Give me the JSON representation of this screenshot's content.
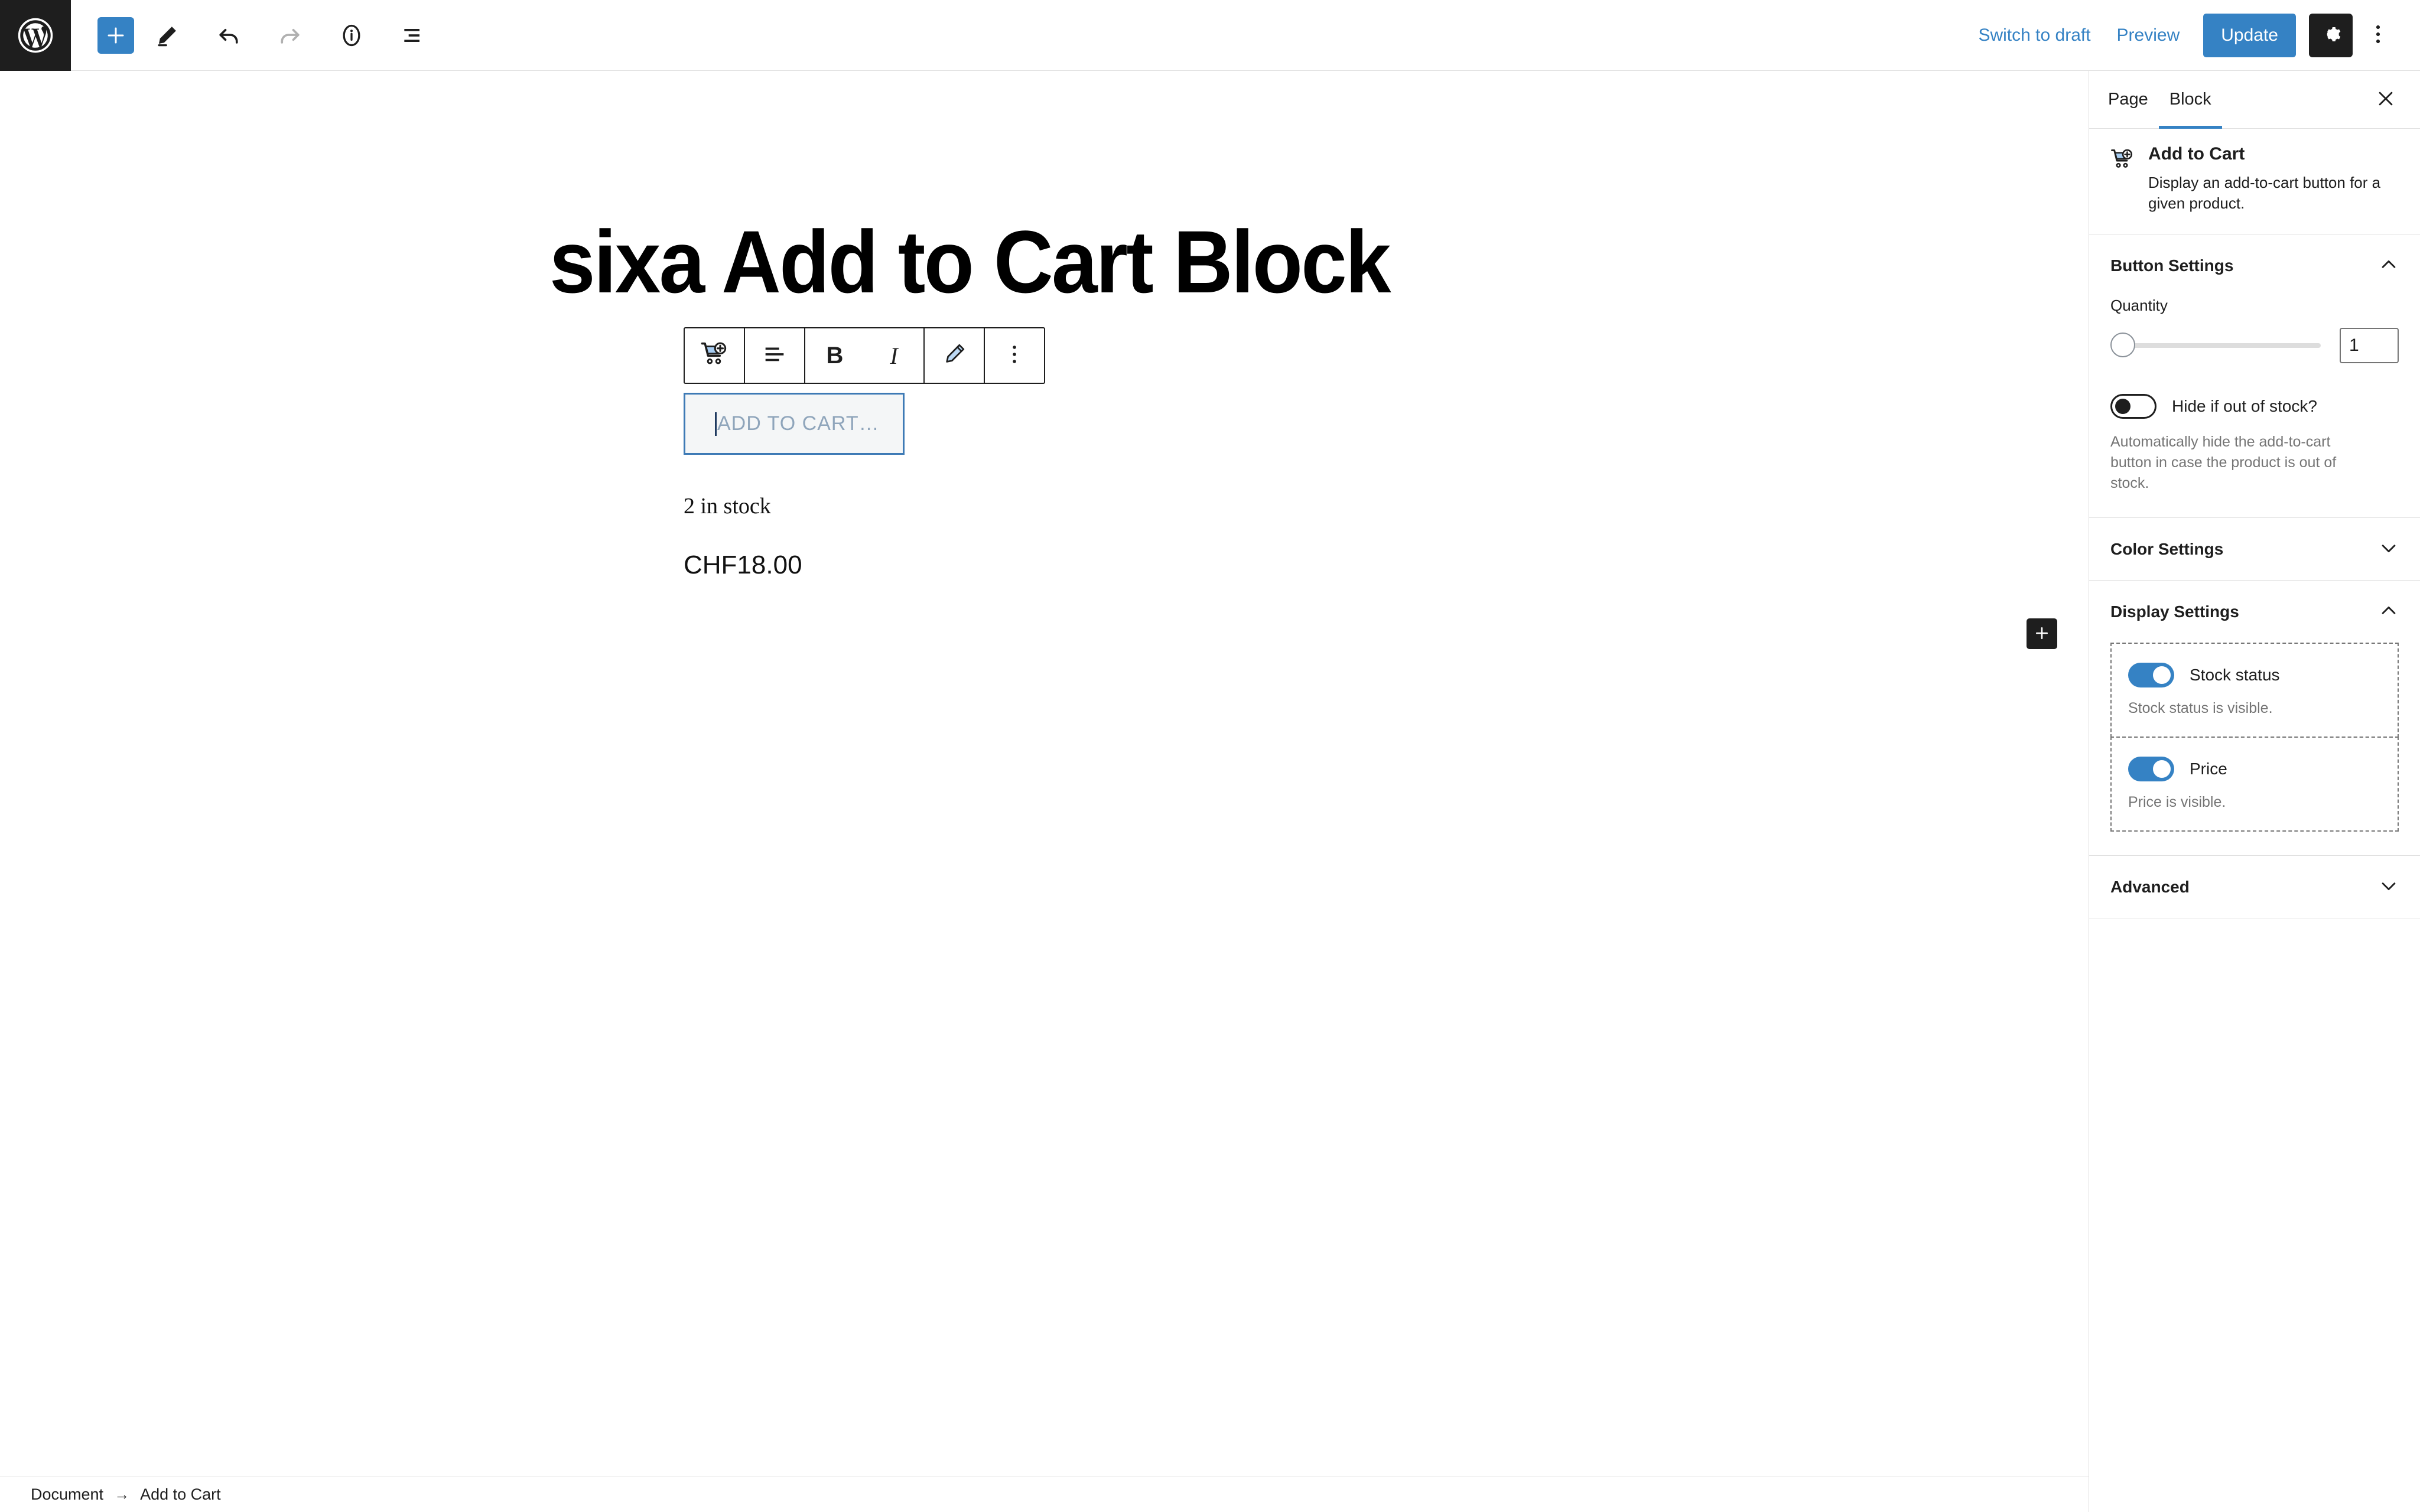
{
  "header": {
    "logo_icon": "wordpress-logo",
    "tools": [
      {
        "name": "add-block-button",
        "icon": "plus-icon"
      },
      {
        "name": "tools-pen-button",
        "icon": "pencil-icon"
      },
      {
        "name": "undo-button",
        "icon": "undo-arrow-icon"
      },
      {
        "name": "redo-button",
        "icon": "redo-arrow-icon"
      },
      {
        "name": "details-button",
        "icon": "info-circle-icon"
      },
      {
        "name": "list-view-button",
        "icon": "list-view-icon"
      }
    ],
    "switch_to_draft": "Switch to draft",
    "preview": "Preview",
    "update": "Update",
    "settings_icon": "gear-icon",
    "more_icon": "three-dots-vertical-icon",
    "accent_blue": "#3582c4",
    "dark": "#1e1e1e"
  },
  "canvas": {
    "post_title": "sixa Add to Cart Block",
    "toolbar": {
      "block_icon": "add-to-cart-icon",
      "align_icon": "align-left-icon",
      "bold_label": "B",
      "italic_label": "I",
      "link_icon": "pencil-icon",
      "more_icon": "three-dots-vertical-icon"
    },
    "add_to_cart_button": {
      "placeholder": "ADD TO CART…",
      "border_color": "#3d7ab5",
      "background": "#f4f6f7",
      "text_color": "#8fa5bb"
    },
    "stock_text": "2 in stock",
    "price_text": "CHF18.00",
    "inserter_icon": "plus-icon"
  },
  "sidebar": {
    "tabs": [
      {
        "label": "Page",
        "active": false
      },
      {
        "label": "Block",
        "active": true
      }
    ],
    "close_icon": "close-x-icon",
    "block_card": {
      "icon": "add-to-cart-icon",
      "title": "Add to Cart",
      "description": "Display an add-to-cart button for a given product."
    },
    "panels": [
      {
        "id": "button-settings",
        "title": "Button Settings",
        "expanded": true,
        "chevron": "chevron-up-icon"
      },
      {
        "id": "color-settings",
        "title": "Color Settings",
        "expanded": false,
        "chevron": "chevron-down-icon"
      },
      {
        "id": "display-settings",
        "title": "Display Settings",
        "expanded": true,
        "chevron": "chevron-up-icon"
      },
      {
        "id": "advanced",
        "title": "Advanced",
        "expanded": false,
        "chevron": "chevron-down-icon"
      }
    ],
    "button_settings": {
      "quantity_label": "Quantity",
      "quantity_value": "1",
      "slider_min": 1,
      "slider_max": 100,
      "slider_position_pct": 0,
      "hide_out_of_stock_label": "Hide if out of stock?",
      "hide_out_of_stock_on": false,
      "hide_out_of_stock_help": "Automatically hide the add-to-cart button in case the product is out of stock."
    },
    "display_settings": {
      "stock_status_label": "Stock status",
      "stock_status_on": true,
      "stock_status_help": "Stock status is visible.",
      "price_label": "Price",
      "price_on": true,
      "price_help": "Price is visible."
    }
  },
  "breadcrumb": {
    "document": "Document",
    "arrow": "→",
    "current": "Add to Cart"
  }
}
